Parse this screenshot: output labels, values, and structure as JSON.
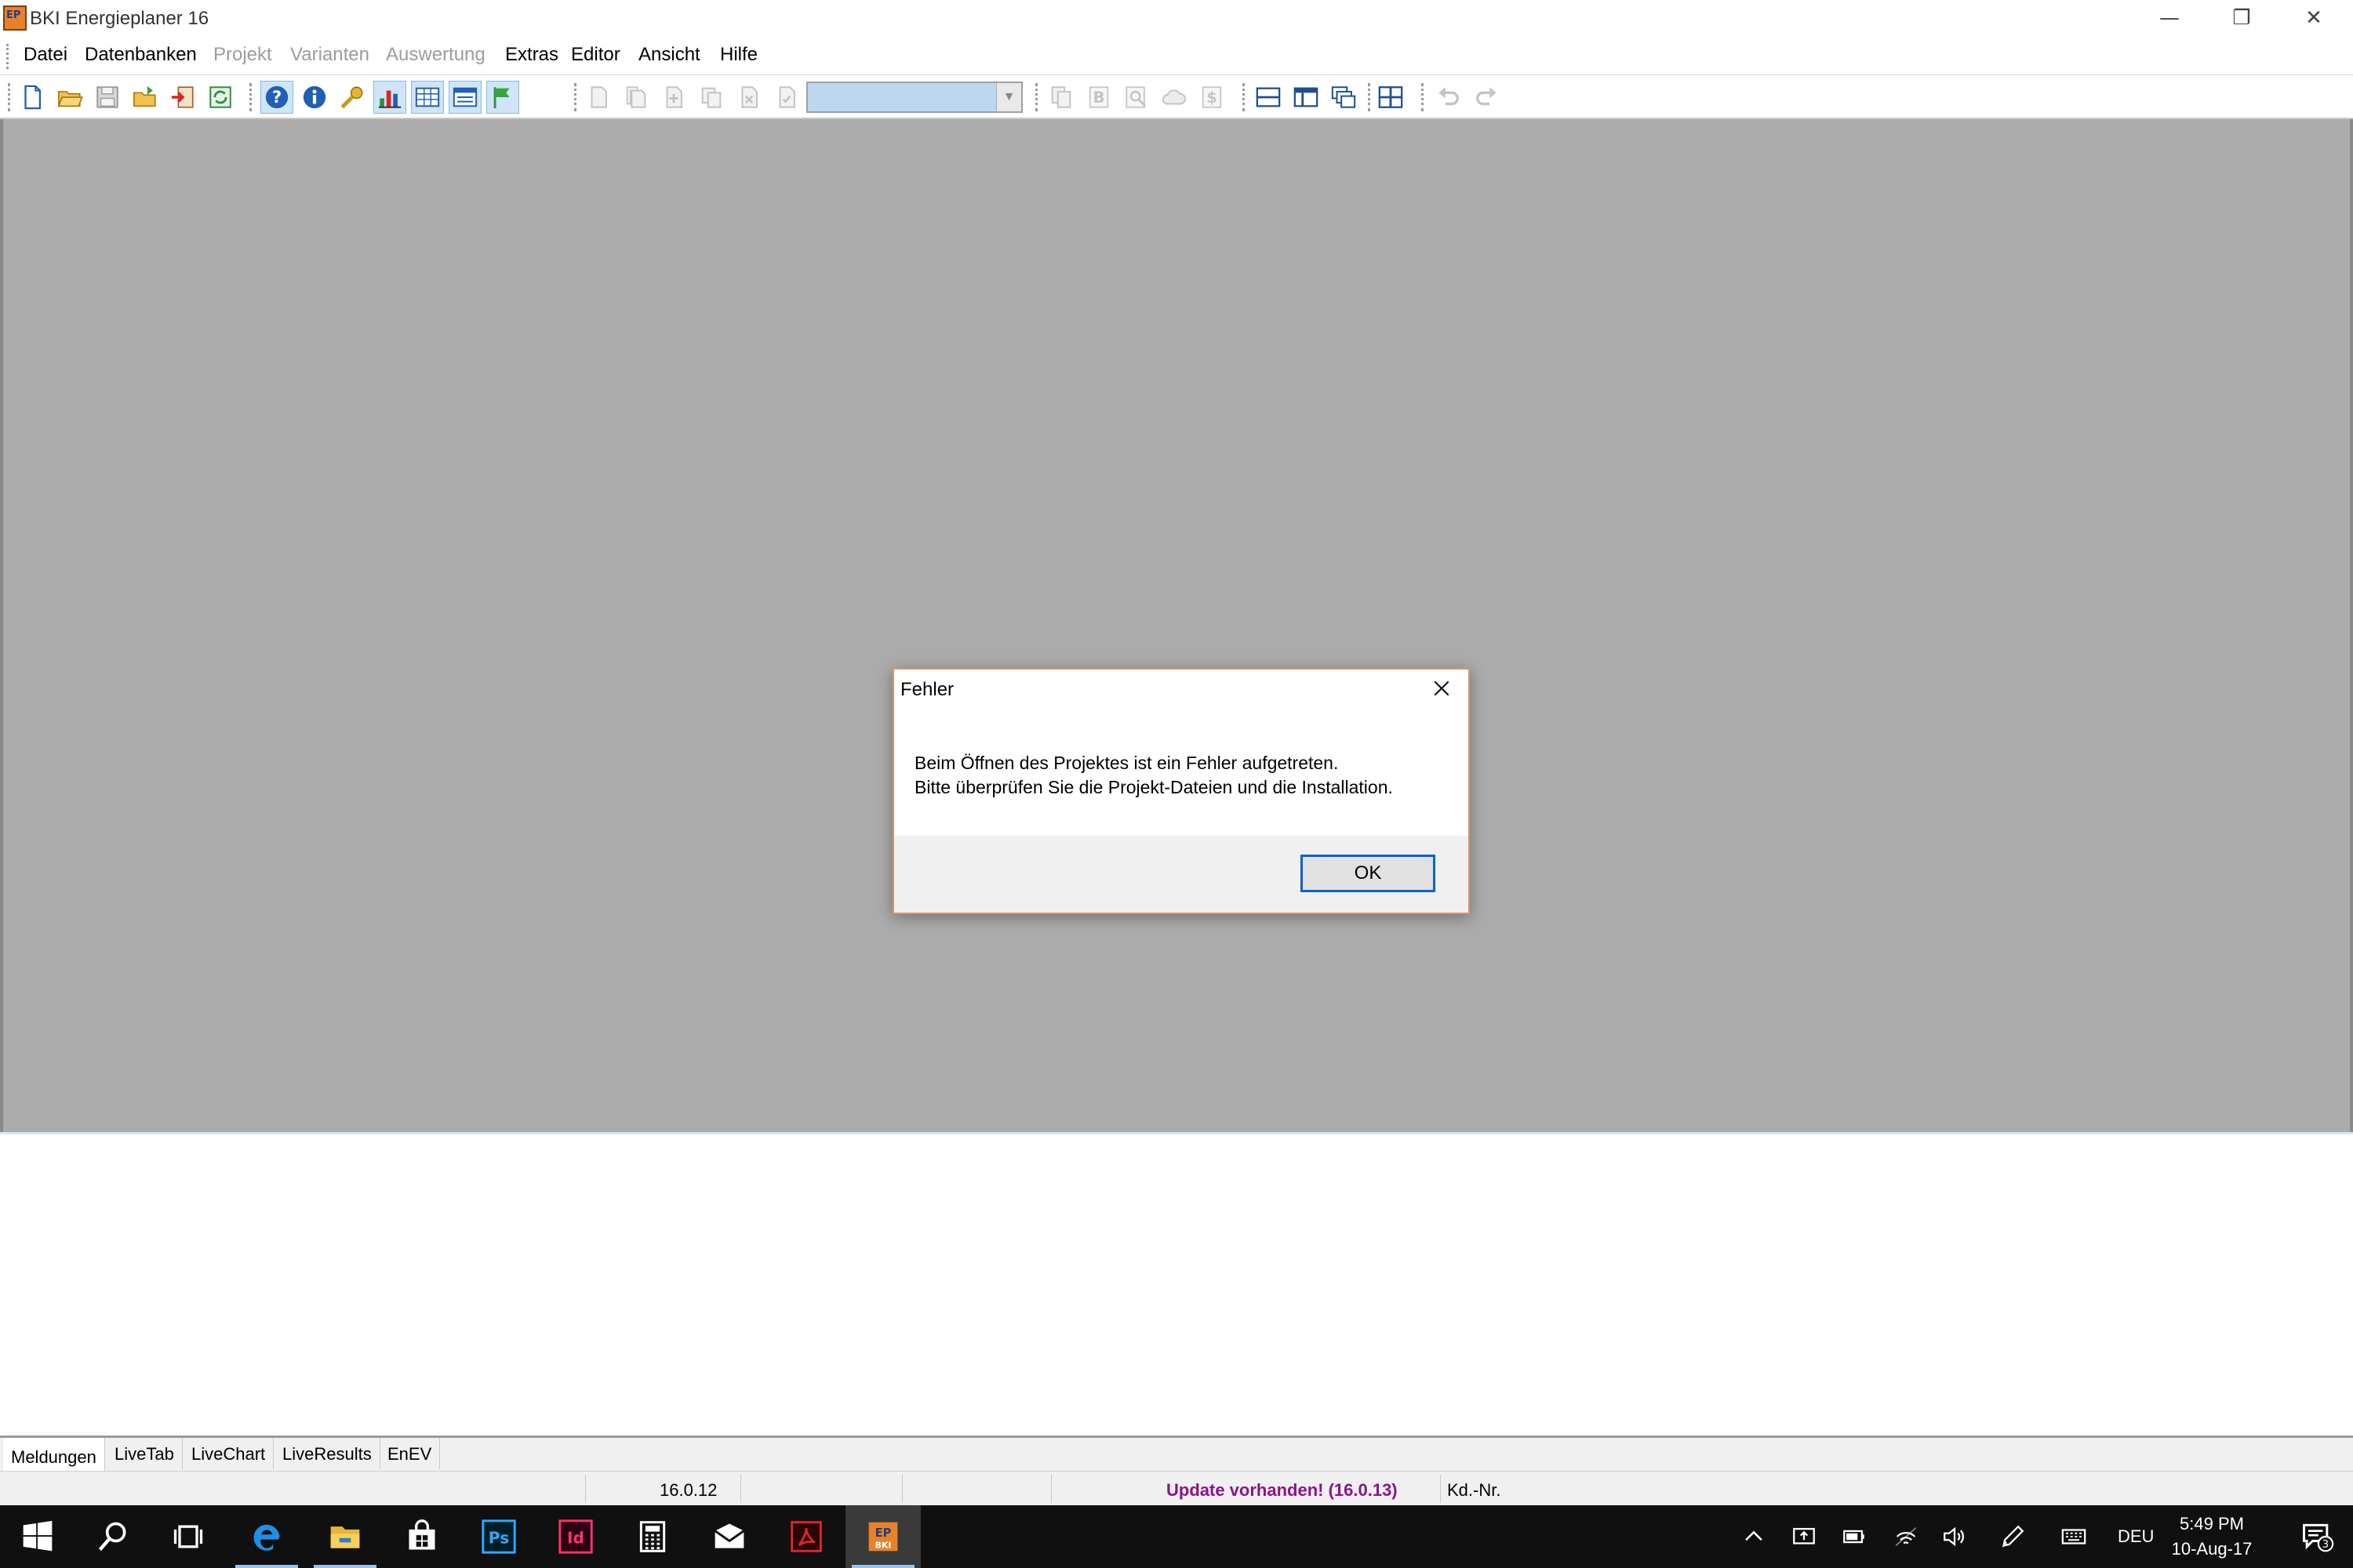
{
  "window": {
    "title": "BKI Energieplaner 16",
    "logo_text": "EP",
    "controls": {
      "minimize": "—",
      "restore": "❐",
      "close": "✕"
    }
  },
  "menu": {
    "items": [
      {
        "label": "Datei",
        "enabled": true
      },
      {
        "label": "Datenbanken",
        "enabled": true
      },
      {
        "label": "Projekt",
        "enabled": false
      },
      {
        "label": "Varianten",
        "enabled": false
      },
      {
        "label": "Auswertung",
        "enabled": false
      },
      {
        "label": "Extras",
        "enabled": true
      },
      {
        "label": "Editor",
        "enabled": true
      },
      {
        "label": "Ansicht",
        "enabled": true
      },
      {
        "label": "Hilfe",
        "enabled": true
      }
    ]
  },
  "toolbar": {
    "buttons": [
      {
        "icon": "new-file-icon"
      },
      {
        "icon": "open-folder-icon"
      },
      {
        "icon": "save-icon"
      },
      {
        "icon": "open-project-icon"
      },
      {
        "icon": "export-icon"
      },
      {
        "icon": "refresh-icon"
      },
      {
        "icon": "help-icon"
      },
      {
        "icon": "info-icon"
      },
      {
        "icon": "key-icon"
      },
      {
        "icon": "bar-chart-icon"
      },
      {
        "icon": "table-icon"
      },
      {
        "icon": "table-list-icon"
      },
      {
        "icon": "flag-icon"
      }
    ],
    "combo_value": ""
  },
  "dialog": {
    "title": "Fehler",
    "message_line1": "Beim Öffnen des Projektes ist ein Fehler aufgetreten.",
    "message_line2": "Bitte überprüfen Sie die Projekt-Dateien und die Installation.",
    "ok_label": "OK"
  },
  "tabs": [
    {
      "label": "Meldungen",
      "active": true
    },
    {
      "label": "LiveTab",
      "active": false
    },
    {
      "label": "LiveChart",
      "active": false
    },
    {
      "label": "LiveResults",
      "active": false
    },
    {
      "label": "EnEV",
      "active": false
    }
  ],
  "status": {
    "version": "16.0.12",
    "update": "Update vorhanden! (16.0.13)",
    "customer_label": "Kd.-Nr."
  },
  "taskbar": {
    "language": "DEU",
    "time": "5:49 PM",
    "date": "10-Aug-17",
    "notifications": "3",
    "apps": [
      {
        "name": "Ps",
        "color": "#31a8ff"
      },
      {
        "name": "Id",
        "color": "#ff3366"
      },
      {
        "name": "BKI",
        "color": "#e8822a"
      }
    ]
  },
  "colors": {
    "workspace": "#ababab",
    "update_text": "#8b148b",
    "dialog_border": "#d8956b",
    "ok_focus": "#0a64c6",
    "taskbar": "#101010"
  }
}
